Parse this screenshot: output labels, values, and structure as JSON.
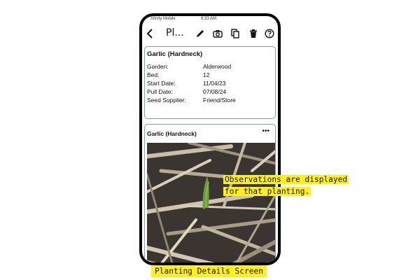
{
  "status_bar": {
    "carrier": "Xfinity Mobile",
    "time": "8:33 AM"
  },
  "toolbar": {
    "title": "Pl...",
    "icons": [
      "back-icon",
      "edit-icon",
      "camera-icon",
      "copy-icon",
      "trash-icon",
      "help-icon"
    ]
  },
  "planting": {
    "name": "Garlic (Hardneck)",
    "fields": [
      {
        "label": "Garden:",
        "value": "Alderwood"
      },
      {
        "label": "Bed:",
        "value": "12"
      },
      {
        "label": "Start Date:",
        "value": "11/04/23"
      },
      {
        "label": "Pull Date:",
        "value": "07/08/24"
      },
      {
        "label": "Seed Supplier:",
        "value": "Friend/Store"
      }
    ]
  },
  "observation": {
    "title": "Garlic (Hardneck)",
    "more": "•••"
  },
  "annotation": {
    "line1": "Observations are displayed",
    "line2": "for that planting.",
    "caption": "Planting Details Screen"
  },
  "colors": {
    "highlight": "#ffef1a",
    "card_border": "#7aa89a",
    "phone_frame": "#000000"
  }
}
